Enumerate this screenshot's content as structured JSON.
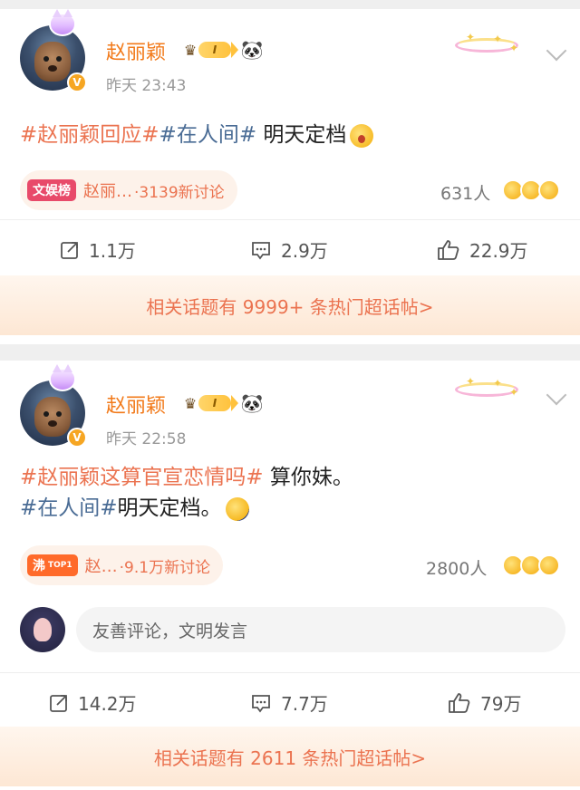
{
  "posts": [
    {
      "author": "赵丽颖",
      "level": "I",
      "time": "昨天 23:43",
      "text": {
        "tag1": "#赵丽颖回应#",
        "tag2": "#在人间#",
        "rest": " 明天定档"
      },
      "topic": {
        "brand": "文娱榜",
        "title": "赵丽…",
        "meta": "·3139新讨论"
      },
      "reaction_count": "631人",
      "actions": {
        "repost": "1.1万",
        "comment": "2.9万",
        "like": "22.9万"
      },
      "related": "相关话题有 9999+ 条热门超话帖>"
    },
    {
      "author": "赵丽颖",
      "level": "I",
      "time": "昨天 22:58",
      "text": {
        "tag1": "#赵丽颖这算官宣恋情吗#",
        "rest1": " 算你妹。",
        "tag2": "#在人间#",
        "rest2": "明天定档。"
      },
      "topic": {
        "brand": "沸",
        "brand_sub": "TOP1",
        "title": "赵…",
        "meta": "·9.1万新讨论"
      },
      "reaction_count": "2800人",
      "comment_placeholder": "友善评论，文明发言",
      "actions": {
        "repost": "14.2万",
        "comment": "7.7万",
        "like": "79万"
      },
      "related": "相关话题有 2611 条热门超话帖>"
    }
  ],
  "icons": {
    "repost": "share-icon",
    "comment": "comment-icon",
    "like": "thumbs-up-icon",
    "more": "chevron-down-icon"
  },
  "colors": {
    "accent": "#eb7350",
    "name": "#f27a1a",
    "tag_blue": "#4a6c95"
  }
}
